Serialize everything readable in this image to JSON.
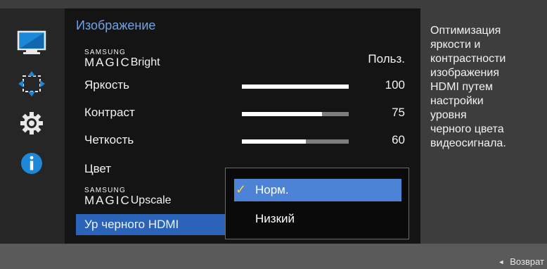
{
  "sidebar": {
    "icons": [
      "monitor-icon",
      "resize-arrows-icon",
      "gear-icon",
      "info-icon"
    ],
    "colors": {
      "accent": "#1e88d8",
      "background": "#262626"
    }
  },
  "menu": {
    "title": "Изображение",
    "rows": [
      {
        "brand_small": "SAMSUNG",
        "brand_big": "MAGIC",
        "label": "Bright",
        "value": "Польз."
      },
      {
        "label": "Яркость",
        "value": "100",
        "slider": 100
      },
      {
        "label": "Контраст",
        "value": "75",
        "slider": 75
      },
      {
        "label": "Четкость",
        "value": "60",
        "slider": 60
      },
      {
        "label": "Цвет"
      },
      {
        "brand_small": "SAMSUNG",
        "brand_big": "MAGIC",
        "label": "Upscale"
      },
      {
        "label": "Ур черного HDMI",
        "selected": true
      }
    ]
  },
  "dropdown": {
    "options": [
      {
        "label": "Норм.",
        "checked": true
      },
      {
        "label": "Низкий"
      }
    ]
  },
  "description": {
    "text": "Оптимизация\nяркости и\nконтрастности\nизображения\nHDMI путем\nнастройки\nуровня\nчерного цвета\nвидеосигнала."
  },
  "footer": {
    "back_label": "Возврат"
  }
}
